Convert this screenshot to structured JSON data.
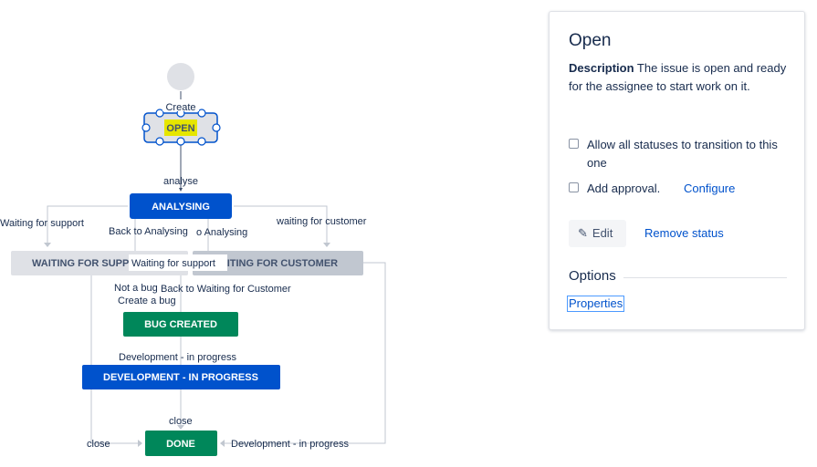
{
  "diagram": {
    "statuses": {
      "open": "OPEN",
      "analysing": "ANALYSING",
      "waiting_support": "WAITING FOR SUPPORT",
      "waiting_customer": "WAITING FOR CUSTOMER",
      "bug_created": "BUG CREATED",
      "development": "DEVELOPMENT - IN PROGRESS",
      "done": "DONE"
    },
    "transitions": {
      "create": "Create",
      "analyse": "analyse",
      "waiting_for_support": "Waiting for support",
      "back_to_analysing_1": "Back to Analysing",
      "back_to_analysing_2": "o Analysing",
      "waiting_for_customer": "waiting for customer",
      "waiting_for_support_box": "Waiting for support",
      "not_a_bug": "Not a bug",
      "back_to_waiting_customer": "Back to Waiting for Customer",
      "create_a_bug": "Create a bug",
      "development_in_progress": "Development - in progress",
      "close_top": "close",
      "close_left": "close",
      "development_in_progress_right": "Development - in progress"
    },
    "colors": {
      "blue": "#0052cc",
      "green": "#00875a",
      "grey": "#dfe1e6",
      "darker_grey": "#c1c7d0",
      "highlight": "#e6e600"
    }
  },
  "panel": {
    "title": "Open",
    "description_label": "Description",
    "description_text": "The issue is open and ready for the assignee to start work on it.",
    "allow_all": "Allow all statuses to transition to this one",
    "add_approval": "Add approval.",
    "configure": "Configure",
    "edit": "Edit",
    "remove_status": "Remove status",
    "options_title": "Options",
    "properties": "Properties"
  }
}
